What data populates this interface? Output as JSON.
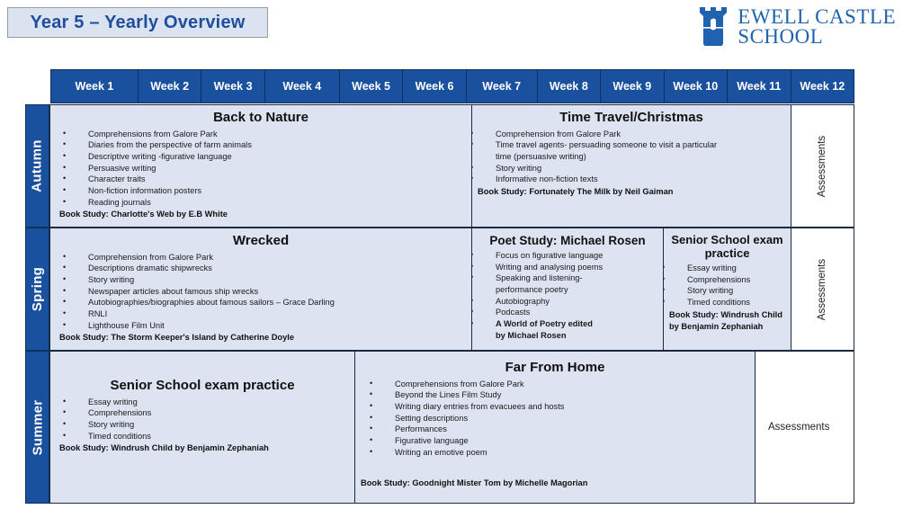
{
  "header": {
    "title": "Year 5 – Yearly Overview",
    "logo": {
      "line1": "EWELL CASTLE",
      "line2": "SCHOOL",
      "mark": "castle-tower-icon",
      "color": "#1f63b0"
    }
  },
  "colors": {
    "header_blue": "#1a519e",
    "cell_fill": "#dde3f0",
    "cell_border": "#1b2b44",
    "title_text": "#1f4e9c",
    "title_fill": "#dbe3f1"
  },
  "table": {
    "week_headers": [
      "Week 1",
      "Week 2",
      "Week 3",
      "Week 4",
      "Week 5",
      "Week 6",
      "Week 7",
      "Week 8",
      "Week 9",
      "Week 10",
      "Week 11",
      "Week 12"
    ],
    "assessments_label": "Assessments",
    "rows": [
      {
        "season": "Autumn",
        "cells": [
          {
            "title": "Back to Nature",
            "bullets": [
              "Comprehensions from Galore Park",
              "Diaries from the perspective of farm animals",
              "Descriptive writing -figurative language",
              " Persuasive writing",
              "Character traits",
              "Non-fiction information posters",
              "Reading journals"
            ],
            "book_study": "Book Study: Charlotte's Web by E.B White"
          },
          {
            "title": "Time Travel/Christmas",
            "bullets": [
              "Comprehension from Galore Park",
              "Time travel agents- persuading someone to visit a particular",
              "time (persuasive writing)",
              "Story writing",
              "Informative non-fiction texts"
            ],
            "book_study": "Book Study: Fortunately The Milk by Neil Gaiman"
          }
        ]
      },
      {
        "season": "Spring",
        "cells": [
          {
            "title": "Wrecked",
            "bullets": [
              "Comprehension from Galore Park",
              "Descriptions dramatic shipwrecks",
              "Story writing",
              "Newspaper articles about famous ship wrecks",
              "Autobiographies/biographies about famous sailors – Grace Darling",
              "RNLI",
              "Lighthouse Film Unit"
            ],
            "book_study": "Book Study: The Storm Keeper's Island by Catherine Doyle"
          },
          {
            "title": "Poet Study: Michael Rosen",
            "bullets": [
              "Focus on figurative language",
              "Writing and analysing poems",
              "Speaking and listening-",
              "performance poetry",
              "Autobiography",
              "Podcasts",
              "A World of Poetry edited",
              "by Michael Rosen"
            ],
            "book_study": ""
          },
          {
            "title": "Senior School exam practice",
            "bullets": [
              "Essay writing",
              "Comprehensions",
              "Story writing",
              "Timed conditions"
            ],
            "book_study": "Book Study: Windrush Child",
            "book_study_line2": "by Benjamin Zephaniah"
          }
        ]
      },
      {
        "season": "Summer",
        "cells": [
          {
            "title": "Senior School exam practice",
            "bullets": [
              "Essay writing",
              "Comprehensions",
              "Story writing",
              "Timed conditions"
            ],
            "book_study": "Book Study: Windrush Child by Benjamin Zephaniah"
          },
          {
            "title": "Far From Home",
            "bullets": [
              "Comprehensions from Galore Park",
              "Beyond the Lines Film Study",
              "Writing diary entries from evacuees and hosts",
              "Setting descriptions",
              "Performances",
              "Figurative language",
              "Writing an emotive poem"
            ],
            "book_study": "Book Study: Goodnight Mister Tom by Michelle Magorian"
          }
        ]
      }
    ]
  }
}
